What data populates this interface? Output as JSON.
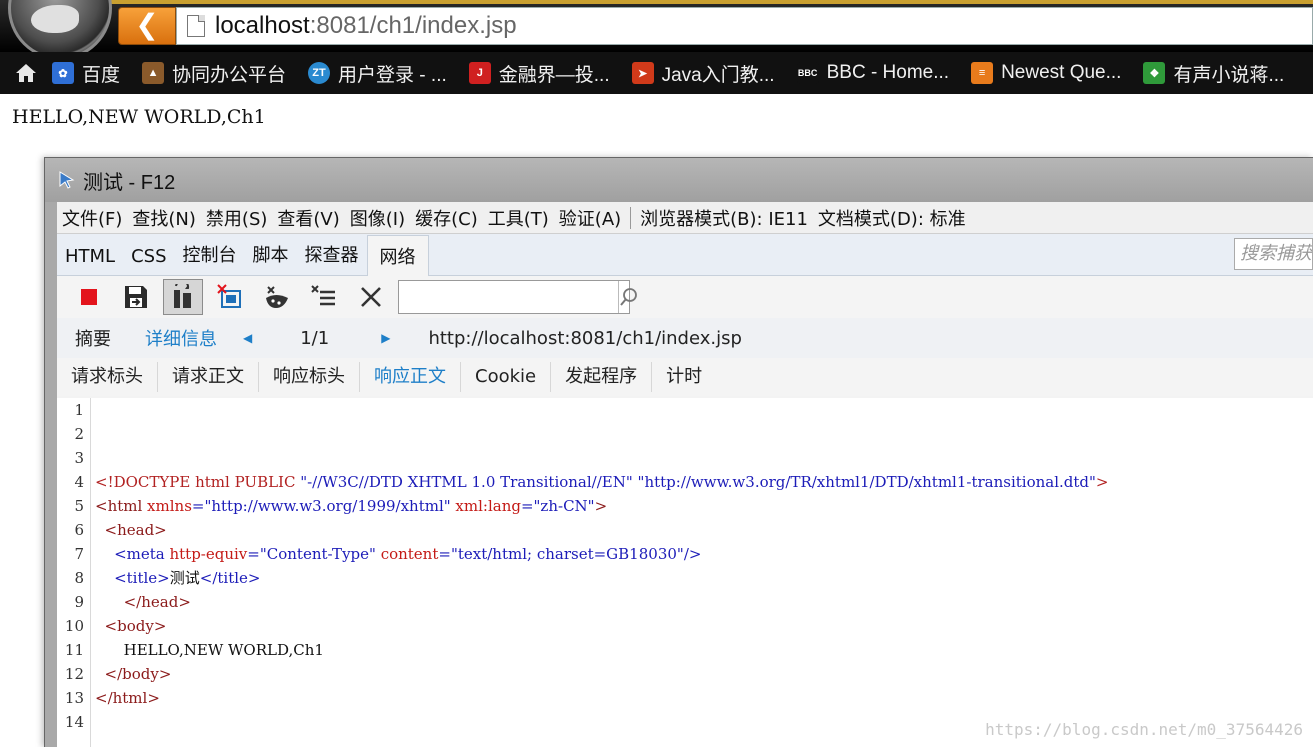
{
  "browser": {
    "url_host": "localhost",
    "url_rest": ":8081/ch1/index.jsp",
    "bookmarks": [
      {
        "label": "百度",
        "icon": "baidu-icon",
        "color": "#2f6fd6"
      },
      {
        "label": "协同办公平台",
        "icon": "deer-icon",
        "color": "#8a5a2b"
      },
      {
        "label": "用户登录 - ...",
        "icon": "zt-icon",
        "color": "#2a8ad0"
      },
      {
        "label": "金融界—投...",
        "icon": "jrj-icon",
        "color": "#d02020"
      },
      {
        "label": "Java入门教...",
        "icon": "bird-icon",
        "color": "#d03a1a"
      },
      {
        "label": "BBC - Home...",
        "icon": "bbc-icon",
        "color": "#111111"
      },
      {
        "label": "Newest Que...",
        "icon": "stackoverflow-icon",
        "color": "#e87b1c"
      },
      {
        "label": "有声小说蒋...",
        "icon": "book-icon",
        "color": "#2f9a3a"
      }
    ]
  },
  "page": {
    "content_text": "HELLO,NEW WORLD,Ch1"
  },
  "devtools": {
    "title": "测试 - F12",
    "menu": [
      "文件(F)",
      "查找(N)",
      "禁用(S)",
      "查看(V)",
      "图像(I)",
      "缓存(C)",
      "工具(T)",
      "验证(A)"
    ],
    "browser_mode": "浏览器模式(B): IE11",
    "doc_mode": "文档模式(D): 标准",
    "tabs": [
      "HTML",
      "CSS",
      "控制台",
      "脚本",
      "探查器",
      "网络"
    ],
    "active_tab": "网络",
    "search_placeholder": "搜索捕获",
    "nav": {
      "summary": "摘要",
      "detail": "详细信息",
      "page": "1/1",
      "url": "http://localhost:8081/ch1/index.jsp"
    },
    "subtabs": [
      "请求标头",
      "请求正文",
      "响应标头",
      "响应正文",
      "Cookie",
      "发起程序",
      "计时"
    ],
    "active_subtab": "响应正文",
    "line_numbers": [
      "1",
      "2",
      "3",
      "4",
      "5",
      "6",
      "7",
      "8",
      "9",
      "10",
      "11",
      "12",
      "13",
      "14"
    ],
    "code": {
      "l4_a": "<!DOCTYPE html PUBLIC ",
      "l4_b": "\"-//W3C//DTD XHTML 1.0 Transitional//EN\"",
      "l4_c": " ",
      "l4_d": "\"http://www.w3.org/TR/xhtml1/DTD/xhtml1-transitional.dtd\"",
      "l4_e": ">",
      "l5_a": "<html ",
      "l5_b": "xmlns",
      "l5_c": "=\"http://www.w3.org/1999/xhtml\"",
      "l5_d": " xml:lang",
      "l5_e": "=\"zh-CN\"",
      "l5_f": ">",
      "l6": "  <head>",
      "l7_a": "    <meta ",
      "l7_b": "http-equiv",
      "l7_c": "=\"Content-Type\"",
      "l7_d": " content",
      "l7_e": "=\"text/html; charset=GB18030\"",
      "l7_f": "/>",
      "l8_a": "    <title>",
      "l8_b": "测试",
      "l8_c": "</title>",
      "l9": "      </head>",
      "l10": "  <body>",
      "l11": "      HELLO,NEW WORLD,Ch1",
      "l12": "  </body>",
      "l13": "</html>"
    },
    "watermark": "https://blog.csdn.net/m0_37564426"
  }
}
